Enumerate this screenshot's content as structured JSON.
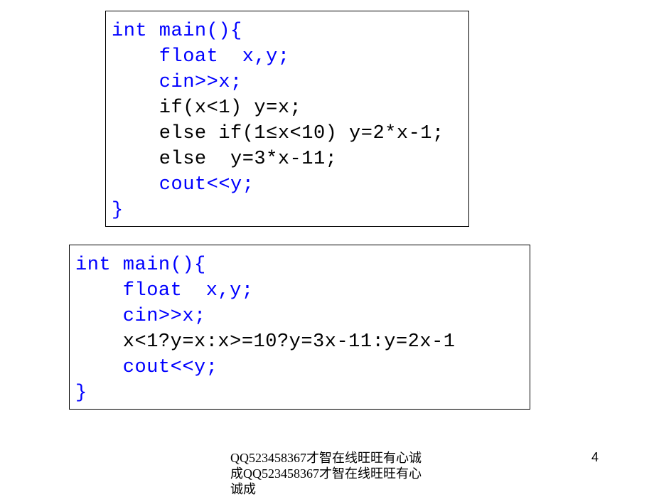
{
  "box1": {
    "line1_a": "int",
    "line1_b": " main(){",
    "line2_a": "    float",
    "line2_b": "  x,y;",
    "line3": "    cin>>x;",
    "line4": "    if(x<1) y=x;",
    "line5": "    else if(1≤x<10) y=2*x-1;",
    "line6": "    else  y=3*x-11;",
    "line7": "    cout<<y;",
    "line8": "}"
  },
  "box2": {
    "line1_a": "int",
    "line1_b": " main(){",
    "line2_a": "    float",
    "line2_b": "  x,y;",
    "line3": "    cin>>x;",
    "line4": "    x<1?y=x:x>=10?y=3x-11:y=2x-1",
    "line5": "    cout<<y;",
    "line6": "}"
  },
  "footer": "QQ523458367才智在线旺旺有心诚成QQ523458367才智在线旺旺有心诚成",
  "pageNum": "4"
}
